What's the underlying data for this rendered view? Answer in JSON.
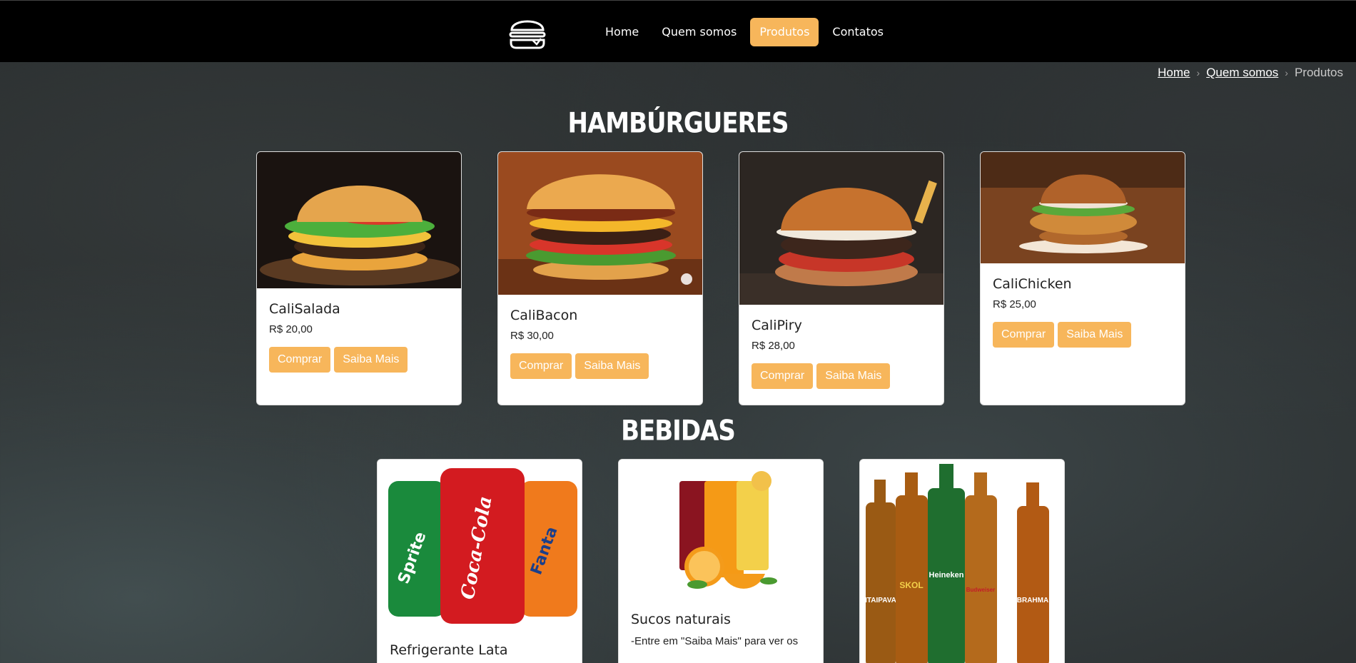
{
  "nav": {
    "links": [
      "Home",
      "Quem somos",
      "Produtos",
      "Contatos"
    ],
    "active_index": 2
  },
  "breadcrumb": {
    "items": [
      "Home",
      "Quem somos",
      "Produtos"
    ]
  },
  "sections": {
    "burgers_title": "HAMBÚRGUERES",
    "drinks_title": "BEBIDAS"
  },
  "burgers": [
    {
      "name": "CaliSalada",
      "price": "R$ 20,00"
    },
    {
      "name": "CaliBacon",
      "price": "R$ 30,00"
    },
    {
      "name": "CaliPiry",
      "price": "R$ 28,00"
    },
    {
      "name": "CaliChicken",
      "price": "R$ 25,00"
    }
  ],
  "buttons": {
    "buy": "Comprar",
    "more": "Saiba Mais"
  },
  "drinks": [
    {
      "name": "Refrigerante Lata",
      "text": ""
    },
    {
      "name": "Sucos naturais",
      "text": "-Entre em \"Saiba Mais\" para ver os"
    },
    {
      "name": "",
      "text": ""
    }
  ],
  "image_labels": {
    "can1": "Sprite",
    "can2": "Coca-Cola",
    "can3": "Fanta",
    "beer1": "ITAIPAVA",
    "beer2": "SKOL",
    "beer3": "Heineken",
    "beer4": "Budweiser",
    "beer5": "BRAHMA"
  },
  "colors": {
    "accent": "#f7b65b",
    "navbar": "#000000",
    "card": "#ffffff"
  }
}
